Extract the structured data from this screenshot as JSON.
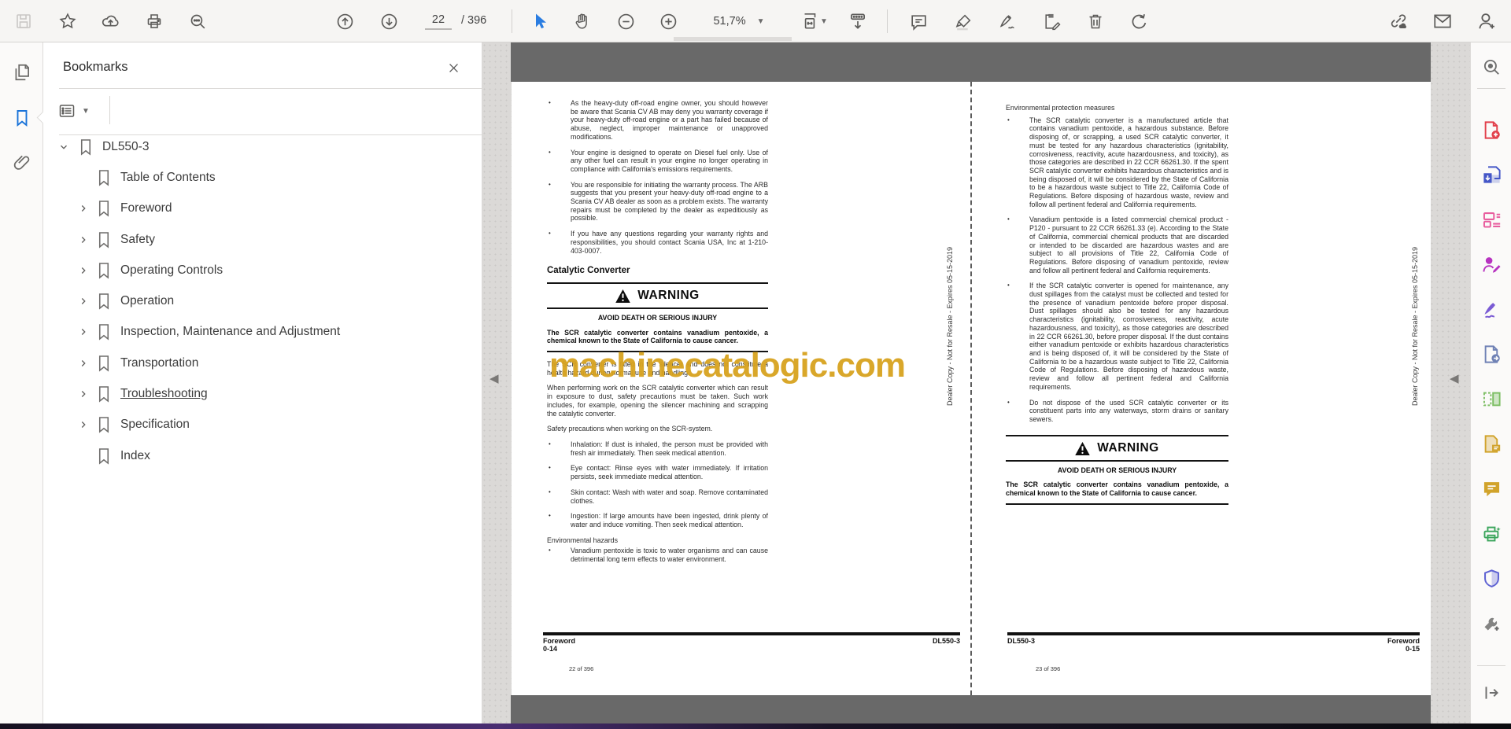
{
  "toolbar": {
    "page_current": "22",
    "page_total": "/ 396",
    "zoom_level": "51,7%",
    "icons": [
      "save-icon",
      "star-icon",
      "share-cloud-icon",
      "print-icon",
      "search-icon",
      "page-up-icon",
      "page-down-icon",
      "select-tool-icon",
      "hand-tool-icon",
      "zoom-out-icon",
      "zoom-in-icon",
      "fit-page-icon",
      "scroll-mode-icon",
      "comment-icon",
      "highlighter-icon",
      "signature-pen-icon",
      "edit-page-icon",
      "trash-icon",
      "redo-icon",
      "share-link-icon",
      "mail-icon",
      "add-person-icon"
    ]
  },
  "panel": {
    "title": "Bookmarks",
    "root": "DL550-3",
    "items": [
      "Table of Contents",
      "Foreword",
      "Safety",
      "Operating Controls",
      "Operation",
      "Inspection, Maintenance and Adjustment",
      "Transportation",
      "Troubleshooting",
      "Specification",
      "Index"
    ]
  },
  "watermark": {
    "text": "machinecatalogic.com",
    "color": "#D8A31F"
  },
  "left_page": {
    "bullets": [
      "As the heavy-duty off-road engine owner, you should however be aware that Scania CV AB may deny you warranty coverage if your heavy-duty off-road engine or a part has failed because of abuse, neglect, improper maintenance or unapproved modifications.",
      "Your engine is designed to operate on Diesel fuel only. Use of any other fuel can result in your engine no longer operating in compliance with California's emissions requirements.",
      "You are responsible for initiating the warranty process. The ARB suggests that you present your heavy-duty off-road engine to a Scania CV AB dealer as soon as a problem exists. The warranty repairs must be completed by the dealer as expeditiously as possible.",
      "If you have any questions regarding your warranty rights and responsibilities, you should contact Scania USA, Inc at 1-210-403-0007."
    ],
    "heading": "Catalytic Converter",
    "warning": {
      "title": "WARNING",
      "subtitle": "AVOID DEATH OR SERIOUS INJURY",
      "body": "The SCR catalytic converter contains vanadium pentoxide, a chemical known to the State of California to cause cancer."
    },
    "paragraphs": [
      "The SCR converter is fitted in the silencer and does not constitute a health hazard during normal use and handling.",
      "When performing work on the SCR catalytic converter which can result in exposure to dust, safety precautions must be taken. Such work includes, for example, opening the silencer machining and scrapping the catalytic converter.",
      "Safety precautions when working on the SCR-system."
    ],
    "safety_bullets": [
      "Inhalation: If dust is inhaled, the person must be provided with fresh air immediately. Then seek medical attention.",
      "Eye contact: Rinse eyes with water immediately. If irritation persists, seek immediate medical attention.",
      "Skin contact: Wash with water and soap. Remove contaminated clothes.",
      "Ingestion: If large amounts have been ingested, drink plenty of water and induce vomiting. Then seek medical attention."
    ],
    "env_heading": "Environmental hazards",
    "env_bullets": [
      "Vanadium pentoxide is toxic to water organisms and can cause detrimental long term effects to water environment."
    ],
    "footer": {
      "section": "Foreword",
      "ref": "0-14",
      "model": "DL550-3"
    },
    "page_label": "22 of 396",
    "side_text": "Dealer Copy - Not for Resale - Expires 05-15-2019"
  },
  "right_page": {
    "heading": "Environmental protection measures",
    "bullets": [
      "The SCR catalytic converter is a manufactured article that contains vanadium pentoxide, a hazardous substance. Before disposing of, or scrapping, a used SCR catalytic converter, it must be tested for any hazardous characteristics (ignitability, corrosiveness, reactivity, acute hazardousness, and toxicity), as those categories are described in 22 CCR 66261.30. If the spent SCR catalytic converter exhibits hazardous characteristics and is being disposed of, it will be considered by the State of California to be a hazardous waste subject to Title 22, California Code of Regulations. Before disposing of hazardous waste, review and follow all pertinent federal and California requirements.",
      "Vanadium pentoxide is a listed commercial chemical product - P120 - pursuant to 22 CCR 66261.33 (e). According to the State of California, commercial chemical products that are discarded or intended to be discarded are hazardous wastes and are subject to all provisions of Title 22, California Code of Regulations. Before disposing of vanadium pentoxide, review and follow all pertinent federal and California requirements.",
      "If the SCR catalytic converter is opened for maintenance, any dust spillages from the catalyst must be collected and tested for the presence of vanadium pentoxide before proper disposal. Dust spillages should also be tested for any hazardous characteristics (ignitability, corrosiveness, reactivity, acute hazardousness, and toxicity), as those categories are described in 22 CCR 66261.30, before proper disposal. If the dust contains either vanadium pentoxide or exhibits hazardous characteristics and is being disposed of, it will be considered by the State of California to be a hazardous waste subject to Title 22, California Code of Regulations. Before disposing of hazardous waste, review and follow all pertinent federal and California requirements.",
      "Do not dispose of the used SCR catalytic converter or its constituent parts into any waterways, storm drains or sanitary sewers."
    ],
    "warning": {
      "title": "WARNING",
      "subtitle": "AVOID DEATH OR SERIOUS INJURY",
      "body": "The SCR catalytic converter contains vanadium pentoxide, a chemical known to the State of California to cause cancer."
    },
    "footer": {
      "model": "DL550-3",
      "section": "Foreword",
      "ref": "0-15"
    },
    "page_label": "23 of 396",
    "side_text": "Dealer Copy - Not for Resale - Expires 05-15-2019"
  },
  "right_tools": [
    {
      "name": "marquee-zoom-icon",
      "color": "#6e6e6e"
    },
    {
      "name": "create-pdf-icon",
      "color": "#E23F4B"
    },
    {
      "name": "combine-files-icon",
      "color": "#4456C7"
    },
    {
      "name": "edit-pdf-icon",
      "color": "#E85D9E"
    },
    {
      "name": "request-signatures-icon",
      "color": "#B733C0"
    },
    {
      "name": "fill-sign-icon",
      "color": "#7A5BD4"
    },
    {
      "name": "export-pdf-icon",
      "color": "#6F81B5"
    },
    {
      "name": "organize-pages-icon",
      "color": "#7CBE63"
    },
    {
      "name": "redact-icon",
      "color": "#D1A32B"
    },
    {
      "name": "comments-icon",
      "color": "#D1A32B"
    },
    {
      "name": "print-production-icon",
      "color": "#3BA55C"
    },
    {
      "name": "protect-icon",
      "color": "#5F63D3"
    },
    {
      "name": "more-tools-icon",
      "color": "#6e6e6e"
    }
  ]
}
